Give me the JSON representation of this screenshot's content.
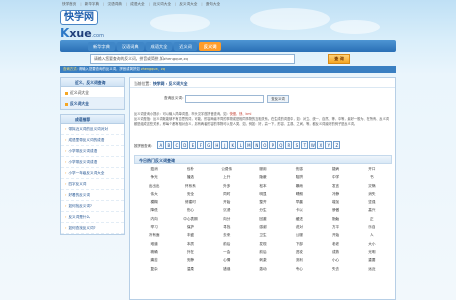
{
  "topbar": {
    "links": [
      "快学首页",
      "新华字典",
      "汉语词典",
      "成语大全",
      "近义词大全",
      "反义词大全",
      "造句大全"
    ]
  },
  "logo": {
    "cn": "快学网",
    "en_k": "K",
    "en_rest": "xue",
    "en_dom": ".com"
  },
  "nav": {
    "items": [
      {
        "label": "新华字典",
        "active": false
      },
      {
        "label": "汉语词典",
        "active": false
      },
      {
        "label": "成语大全",
        "active": false
      },
      {
        "label": "近义词",
        "active": false
      },
      {
        "label": "反义词",
        "active": true
      }
    ]
  },
  "search": {
    "value": "请输入您要查询的反义词，拼音或简拼,如zhengque,zq",
    "button": "查 询"
  },
  "hotline": {
    "key1": "查询方式:",
    "text1": "请输入您要查询的反义词，拼音或简拼如",
    "key2": "zhengque、zq"
  },
  "sidebar": {
    "box1": {
      "title": "近义、反义词查询",
      "items": [
        {
          "label": "近义词大全",
          "selected": false
        },
        {
          "label": "反义词大全",
          "selected": true
        }
      ]
    },
    "box2": {
      "title": "成语推荐",
      "links": [
        "带拟近义词的反义词对对",
        "成语里带反义词的成语",
        "小学带反义词成语",
        "小学带反义词成语",
        "小学一年级反义词大全",
        "四字反义词",
        "好看的反义词",
        "如何找反义词?",
        "反义词是什么",
        "如何查找反义词?"
      ]
    }
  },
  "main": {
    "crumb_prefix": "当前位置：",
    "crumb_current": "快学网 › 反义词大全",
    "query_label": "查询反义词：",
    "query_button": "查反义词",
    "desc_1": "反义词查询小提示：可以输入简单词语，市头汉字首拼音查询，如：",
    "desc_hl": "快慢、快、kml",
    "desc_2": "反义词是指：反义词既能够不有意思的词，可能，形容两者不同的事物或是相同事物的互相关系。在生成的词语中，如：对立、统一、自然、等、中等，最好一般为、在所有、反义词都是组成这些关系，即每个都有相对含义，另有两者形容的事物可以是人类、如，例如：好，高一下，形容、主观、之间，等，都反义词最好的例子是反义词。",
    "alpha_label": "按拼音查询：",
    "letters": [
      "A",
      "B",
      "C",
      "D",
      "E",
      "F",
      "G",
      "H",
      "J",
      "K",
      "L",
      "M",
      "N",
      "O",
      "P",
      "Q",
      "R",
      "S",
      "T",
      "W",
      "X",
      "Y",
      "Z"
    ],
    "hot_title": "今日热门反义词查询",
    "words": [
      "蕴消",
      "俭朴",
      "公费传",
      "服用",
      "伤感",
      "疑病",
      "开口",
      "争光",
      "播选",
      "上升",
      "隐蔽",
      "陷阱",
      "中学",
      "书",
      "出出出",
      "怀系系",
      "外多",
      "松本",
      "暴雨",
      "发言",
      "灾祸",
      "伟大",
      "安全",
      "同时",
      "明显",
      "晴朗",
      "冷静",
      "消失",
      "模糊",
      "修建时",
      "开始",
      "整齐",
      "早晨",
      "增加",
      "坚强",
      "降低",
      "伤心",
      "沉浸",
      "分生",
      "卡以",
      "骄傲",
      "高兴",
      "内向",
      "中心表期",
      "向分",
      "回避",
      "缓进",
      "勤勉",
      "正",
      "举习",
      "保护",
      "寻找",
      "感谢",
      "说对",
      "方平",
      "乐自",
      "冷有面",
      "丰盛",
      "去来",
      "卫生",
      "公服",
      "开始",
      "人",
      "难道",
      "本质",
      "前后",
      "发现",
      "下部",
      "老老",
      "大小",
      "精确",
      "外在",
      "一会",
      "前后",
      "进攻",
      "成熟",
      "光明",
      "痛苦",
      "安静",
      "心情",
      "刺激",
      "流利",
      "小心",
      "重要",
      "复杂",
      "温柔",
      "错误",
      "激动",
      "专心",
      "失去",
      "远近"
    ]
  }
}
